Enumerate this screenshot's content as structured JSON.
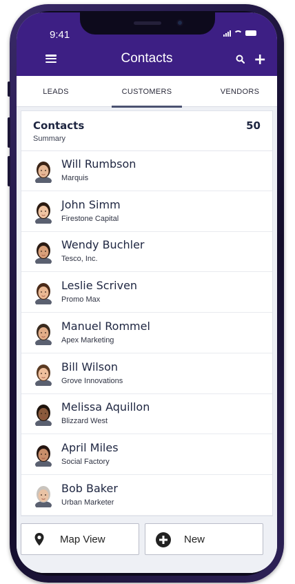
{
  "status_bar": {
    "time": "9:41"
  },
  "header": {
    "title": "Contacts"
  },
  "tabs": [
    {
      "label": "LEADS",
      "active": false
    },
    {
      "label": "CUSTOMERS",
      "active": true
    },
    {
      "label": "VENDORS",
      "active": false
    }
  ],
  "summary": {
    "title": "Contacts",
    "subtitle": "Summary",
    "count": "50"
  },
  "contacts": [
    {
      "name": "Will Rumbson",
      "company": "Marquis"
    },
    {
      "name": "John Simm",
      "company": "Firestone Capital"
    },
    {
      "name": "Wendy Buchler",
      "company": "Tesco, Inc."
    },
    {
      "name": "Leslie Scriven",
      "company": "Promo Max"
    },
    {
      "name": "Manuel Rommel",
      "company": "Apex Marketing"
    },
    {
      "name": "Bill Wilson",
      "company": "Grove Innovations"
    },
    {
      "name": "Melissa Aquillon",
      "company": "Blizzard West"
    },
    {
      "name": "April Miles",
      "company": "Social Factory"
    },
    {
      "name": "Bob Baker",
      "company": "Urban Marketer"
    }
  ],
  "actions": {
    "map_view": "Map View",
    "new": "New"
  },
  "colors": {
    "brand": "#3d1f84",
    "text": "#1d2540",
    "tab_underline": "#4a5170"
  },
  "icons": {
    "menu": "hamburger-icon",
    "search": "search-icon",
    "add": "plus-icon",
    "map": "map-pin-icon",
    "new": "plus-circle-icon"
  }
}
